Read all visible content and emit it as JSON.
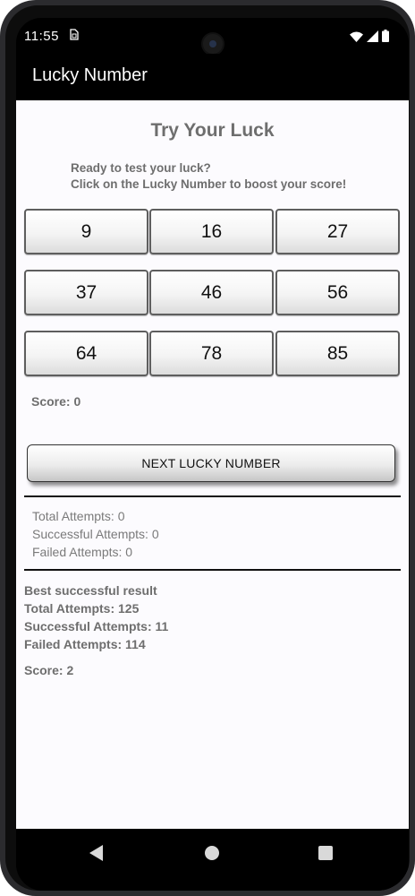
{
  "status": {
    "time": "11:55",
    "icons": [
      "sim-card-icon",
      "wifi-icon",
      "signal-icon",
      "battery-icon"
    ]
  },
  "app": {
    "title": "Lucky Number"
  },
  "game": {
    "heading": "Try Your Luck",
    "subtitle_line1": "Ready to test your luck?",
    "subtitle_line2": "Click on the Lucky Number to boost your score!",
    "numbers": [
      "9",
      "16",
      "27",
      "37",
      "46",
      "56",
      "64",
      "78",
      "85"
    ],
    "score_label": "Score: 0",
    "next_button": "NEXT LUCKY NUMBER"
  },
  "current_stats": {
    "total": "Total Attempts: 0",
    "successful": "Successful Attempts: 0",
    "failed": "Failed Attempts:  0"
  },
  "best_result": {
    "heading": "Best successful result",
    "total": "Total Attempts: 125",
    "successful": "Successful Attempts: 11",
    "failed": "Failed Attempts:  114",
    "score": "Score: 2"
  },
  "colors": {
    "app_bar": "#000000",
    "content_bg": "#fcfbfe",
    "muted_text": "#6e6e6e"
  }
}
